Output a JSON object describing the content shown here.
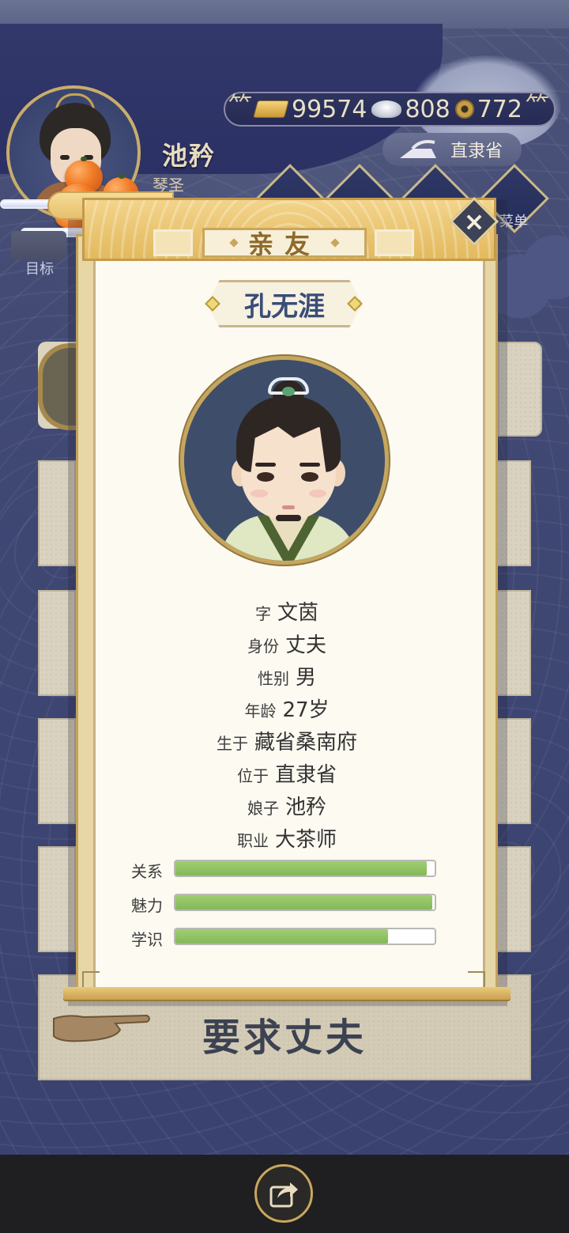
{
  "player": {
    "name": "池矜",
    "title": "琴圣",
    "goal_label": "目标"
  },
  "currency": {
    "gold": "99574",
    "silver": "808",
    "coins": "772"
  },
  "location": "直隶省",
  "menu_label_partial": "菜单",
  "dialog": {
    "title": "亲友",
    "person_name": "孔无涯",
    "info": [
      {
        "label": "字",
        "value": "文茵"
      },
      {
        "label": "身份",
        "value": "丈夫"
      },
      {
        "label": "性别",
        "value": "男"
      },
      {
        "label": "年龄",
        "value": "27岁"
      },
      {
        "label": "生于",
        "value": "藏省桑南府"
      },
      {
        "label": "位于",
        "value": "直隶省"
      },
      {
        "label": "娘子",
        "value": "池矜"
      },
      {
        "label": "职业",
        "value": "大茶师"
      }
    ],
    "stats": [
      {
        "label": "关系",
        "fill": 0.97
      },
      {
        "label": "魅力",
        "fill": 0.99
      },
      {
        "label": "学识",
        "fill": 0.82
      }
    ]
  },
  "action_button": "要求丈夫",
  "colors": {
    "accent_gold": "#c9a65a",
    "bar_green": "#8cc061",
    "name_blue": "#3a4d7a"
  },
  "icons": [
    "gold-bar-icon",
    "silver-ingot-icon",
    "coin-icon",
    "close-icon",
    "pointing-hand-icon",
    "share-icon"
  ]
}
